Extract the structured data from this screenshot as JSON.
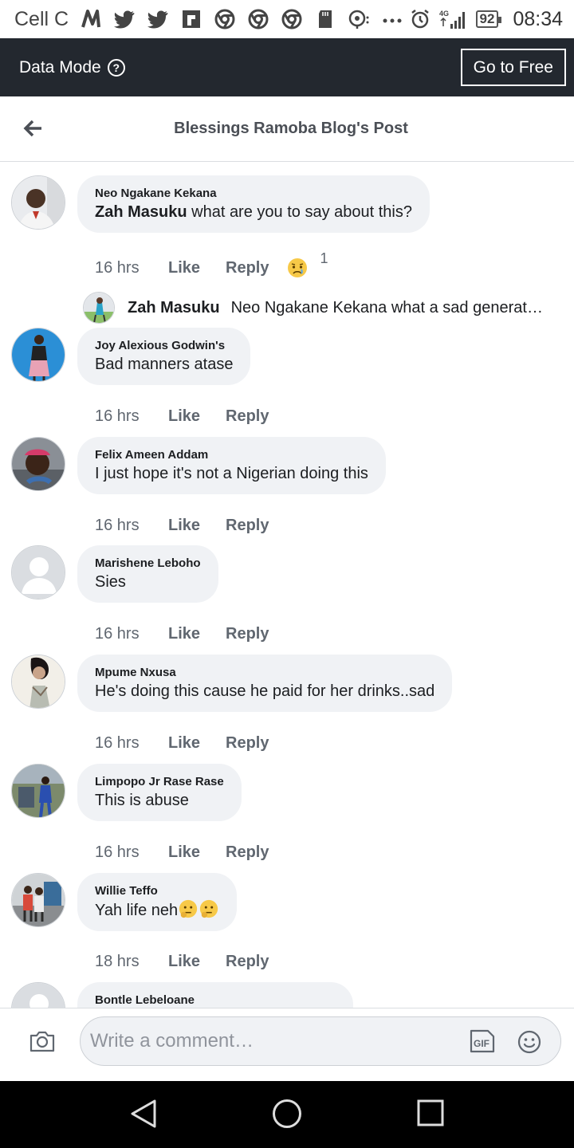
{
  "status_bar": {
    "carrier": "Cell C",
    "network": "4G",
    "battery": "92",
    "time": "08:34",
    "icons": [
      "nfc-icon",
      "twitter-icon",
      "twitter-icon",
      "flipboard-icon",
      "chrome-icon",
      "chrome-icon",
      "chrome-icon",
      "sd-card-icon",
      "hotspot-icon",
      "more-dots-icon",
      "alarm-icon",
      "signal-icon"
    ]
  },
  "data_mode": {
    "label": "Data Mode",
    "help": "?",
    "go_free": "Go to Free"
  },
  "header": {
    "title": "Blessings Ramoba Blog's Post"
  },
  "comments": [
    {
      "name": "Neo Ngakane Kekana",
      "mention": "Zah Masuku",
      "text": " what are you to say about this?",
      "time": "16 hrs",
      "like": "Like",
      "reply": "Reply",
      "reaction_count": "1",
      "sub_reply": {
        "name": "Zah Masuku",
        "text": "Neo Ngakane Kekana what a sad generation"
      }
    },
    {
      "name": "Joy Alexious Godwin's",
      "text": "Bad manners atase",
      "time": "16 hrs",
      "like": "Like",
      "reply": "Reply"
    },
    {
      "name": "Felix Ameen Addam",
      "text": "I just hope it's not a Nigerian doing this",
      "time": "16 hrs",
      "like": "Like",
      "reply": "Reply"
    },
    {
      "name": "Marishene Leboho",
      "text": "Sies",
      "time": "16 hrs",
      "like": "Like",
      "reply": "Reply"
    },
    {
      "name": "Mpume Nxusa",
      "text": "He's doing this cause he paid for her drinks..sad",
      "time": "16 hrs",
      "like": "Like",
      "reply": "Reply"
    },
    {
      "name": "Limpopo Jr Rase Rase",
      "text": "This is abuse",
      "time": "16 hrs",
      "like": "Like",
      "reply": "Reply"
    },
    {
      "name": "Willie Teffo",
      "text": "Yah life neh",
      "time": "18 hrs",
      "like": "Like",
      "reply": "Reply"
    },
    {
      "name": "Bontle Lebeloane"
    }
  ],
  "composer": {
    "placeholder": "Write a comment…"
  },
  "colors": {
    "data_bar_bg": "#23282f",
    "bubble_bg": "#f0f2f5",
    "meta_text": "#606770"
  }
}
